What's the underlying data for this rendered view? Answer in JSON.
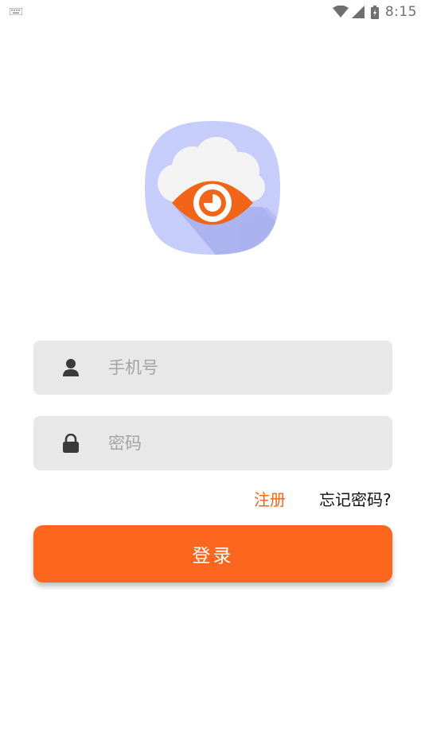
{
  "status_bar": {
    "time": "8:15",
    "icons": [
      "keyboard-icon",
      "wifi-icon",
      "cell-signal-icon",
      "battery-icon"
    ]
  },
  "logo": {
    "icon": "cloud-eye-logo-icon",
    "colors": {
      "background": "#c7cdfa",
      "cloud": "#f2f2f2",
      "eye": "#f26418"
    }
  },
  "login_form": {
    "phone": {
      "placeholder": "手机号",
      "value": "",
      "icon": "user-icon"
    },
    "password": {
      "placeholder": "密码",
      "value": "",
      "icon": "lock-icon"
    },
    "register_label": "注册",
    "forgot_label": "忘记密码?",
    "login_label": "登录"
  },
  "colors": {
    "accent": "#fd661e",
    "field_background": "#e8e8e8",
    "placeholder": "#a3a3a3"
  }
}
